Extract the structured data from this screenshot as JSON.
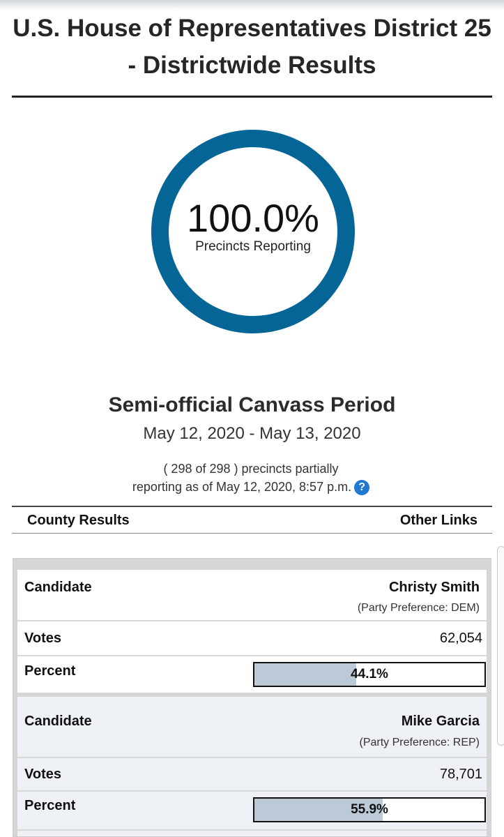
{
  "header": {
    "title": "U.S. House of Representatives District 25 - Districtwide Results"
  },
  "reporting": {
    "percent_text": "100.0%",
    "label": "Precincts Reporting",
    "ring_color": "#066597",
    "fraction_reporting": 1.0
  },
  "canvass": {
    "title": "Semi-official Canvass Period",
    "dates": "May 12, 2020 - May 13, 2020",
    "precincts_line1": "( 298 of 298 ) precincts partially",
    "precincts_line2": "reporting as of May 12, 2020, 8:57 p.m.",
    "help_icon": "question-circle-icon",
    "help_glyph": "?"
  },
  "links": {
    "county_results": "County Results",
    "other_links": "Other Links"
  },
  "candidates": [
    {
      "candidate_label": "Candidate",
      "name": "Christy Smith",
      "party": "(Party Preference: DEM)",
      "votes_label": "Votes",
      "votes": "62,054",
      "percent_label": "Percent",
      "percent_text": "44.1%",
      "percent_value": 44.1
    },
    {
      "candidate_label": "Candidate",
      "name": "Mike Garcia",
      "party": "(Party Preference: REP)",
      "votes_label": "Votes",
      "votes": "78,701",
      "percent_label": "Percent",
      "percent_text": "55.9%",
      "percent_value": 55.9
    }
  ],
  "colors": {
    "accent": "#066597",
    "bar_fill": "#bccad8",
    "card_alt_bg": "#eef2f6"
  }
}
